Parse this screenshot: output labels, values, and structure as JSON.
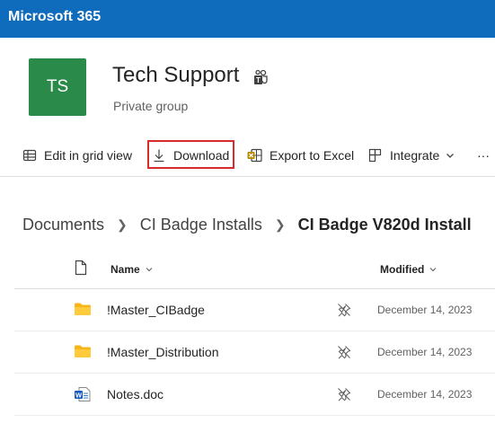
{
  "app": {
    "title": "Microsoft 365"
  },
  "site": {
    "logo_initials": "TS",
    "logo_color": "#2a8a4a",
    "title": "Tech Support",
    "subtitle": "Private group"
  },
  "commands": {
    "edit_grid": "Edit in grid view",
    "download": "Download",
    "export_excel": "Export to Excel",
    "integrate": "Integrate",
    "more": "···"
  },
  "breadcrumb": {
    "items": [
      "Documents",
      "CI Badge Installs"
    ],
    "current": "CI Badge V820d Install"
  },
  "columns": {
    "name": "Name",
    "modified": "Modified"
  },
  "files": [
    {
      "name": "!Master_CIBadge",
      "type": "folder",
      "modified": "December 14, 2023"
    },
    {
      "name": "!Master_Distribution",
      "type": "folder",
      "modified": "December 14, 2023"
    },
    {
      "name": "Notes.doc",
      "type": "word-document",
      "modified": "December 14, 2023"
    }
  ],
  "colors": {
    "topbar": "#0f6cbd",
    "highlight": "#d62b2b"
  }
}
